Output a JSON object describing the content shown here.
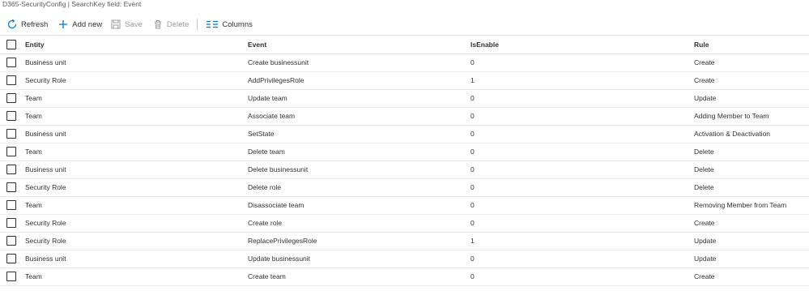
{
  "title": "D365-SecurityConfig | SearchKey field: Event",
  "toolbar": {
    "refresh": "Refresh",
    "add_new": "Add new",
    "save": "Save",
    "delete": "Delete",
    "columns": "Columns",
    "accent_color": "#0078d4",
    "disabled_color": "#a19f9d"
  },
  "columns": {
    "entity": "Entity",
    "event": "Event",
    "isenable": "IsEnable",
    "rule": "Rule"
  },
  "rows": [
    {
      "entity": "Business unit",
      "event": "Create businessunit",
      "isenable": "0",
      "rule": "Create"
    },
    {
      "entity": "Security Role",
      "event": "AddPrivilegesRole",
      "isenable": "1",
      "rule": "Create"
    },
    {
      "entity": "Team",
      "event": "Update team",
      "isenable": "0",
      "rule": "Update"
    },
    {
      "entity": "Team",
      "event": "Associate team",
      "isenable": "0",
      "rule": "Adding Member to Team"
    },
    {
      "entity": "Business unit",
      "event": "SetState",
      "isenable": "0",
      "rule": "Activation & Deactivation"
    },
    {
      "entity": "Team",
      "event": "Delete team",
      "isenable": "0",
      "rule": "Delete"
    },
    {
      "entity": "Business unit",
      "event": "Delete businessunit",
      "isenable": "0",
      "rule": "Delete"
    },
    {
      "entity": "Security Role",
      "event": "Delete role",
      "isenable": "0",
      "rule": "Delete"
    },
    {
      "entity": "Team",
      "event": "Disassociate team",
      "isenable": "0",
      "rule": "Removing Member from Team"
    },
    {
      "entity": "Security Role",
      "event": "Create role",
      "isenable": "0",
      "rule": "Create"
    },
    {
      "entity": "Security Role",
      "event": "ReplacePrivilegesRole",
      "isenable": "1",
      "rule": "Update"
    },
    {
      "entity": "Business unit",
      "event": "Update businessunit",
      "isenable": "0",
      "rule": "Update"
    },
    {
      "entity": "Team",
      "event": "Create team",
      "isenable": "0",
      "rule": "Create"
    }
  ]
}
